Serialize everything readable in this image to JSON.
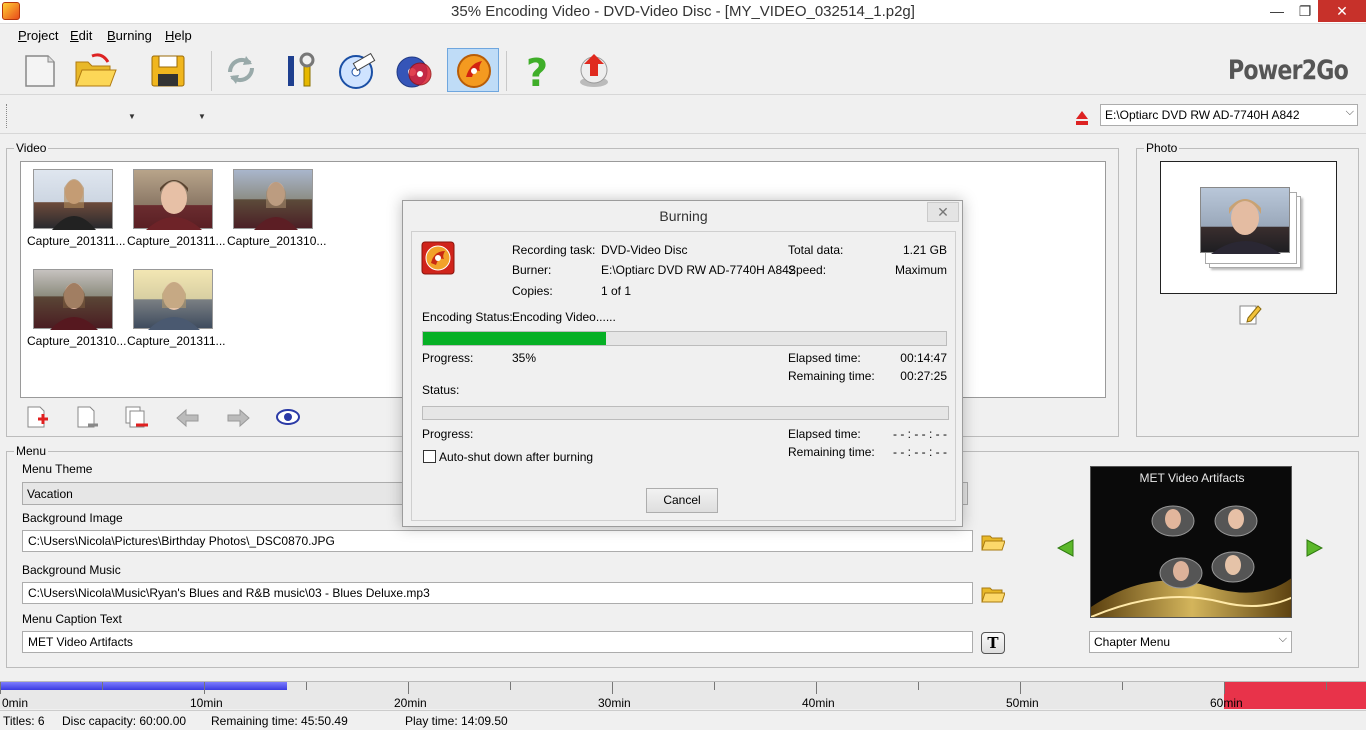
{
  "window": {
    "title": "35% Encoding Video - DVD-Video Disc - [MY_VIDEO_032514_1.p2g]",
    "min_icon": "minimize-icon",
    "max_icon": "maximize-icon",
    "close_icon": "close-icon",
    "min_glyph": "—",
    "max_glyph": "❐",
    "close_glyph": "✕"
  },
  "menubar": {
    "items": [
      "Project",
      "Edit",
      "Burning",
      "Help"
    ]
  },
  "toolbar": {
    "brand": "Power2Go",
    "buttons": [
      "new-project",
      "open-project",
      "save-project",
      "refresh",
      "tools",
      "burn-settings",
      "disc-utilities",
      "burn",
      "help",
      "update"
    ]
  },
  "drive": {
    "selected": "E:\\Optiarc DVD RW AD-7740H A842"
  },
  "video": {
    "label": "Video",
    "items": [
      {
        "label": "Capture_201311..."
      },
      {
        "label": "Capture_201311..."
      },
      {
        "label": "Capture_201310..."
      },
      {
        "label": "Capture_201310..."
      },
      {
        "label": "Capture_201311..."
      }
    ]
  },
  "photo": {
    "label": "Photo"
  },
  "menu": {
    "label": "Menu",
    "theme_label": "Menu Theme",
    "theme_value": "Vacation",
    "bg_image_label": "Background Image",
    "bg_image_value": "C:\\Users\\Nicola\\Pictures\\Birthday Photos\\_DSC0870.JPG",
    "bg_music_label": "Background Music",
    "bg_music_value": "C:\\Users\\Nicola\\Music\\Ryan's Blues and R&B music\\03 - Blues Deluxe.mp3",
    "caption_label": "Menu Caption Text",
    "caption_value": "MET Video Artifacts",
    "text_button": "T",
    "preview_title": "MET Video Artifacts",
    "chapter_select": "Chapter Menu"
  },
  "timeline": {
    "labels": [
      "0min",
      "10min",
      "20min",
      "30min",
      "40min",
      "50min",
      "60min"
    ],
    "used_fraction": 0.2347,
    "colors": {
      "used": "#4a4ae8",
      "over": "#e8334a"
    }
  },
  "status": {
    "titles": "Titles: 6",
    "capacity": "Disc capacity: 60:00.00",
    "remaining": "Remaining time: 45:50.49",
    "play": "Play time: 14:09.50"
  },
  "dialog": {
    "title": "Burning",
    "recording_task_label": "Recording task:",
    "recording_task_value": "DVD-Video Disc",
    "burner_label": "Burner:",
    "burner_value": "E:\\Optiarc DVD RW AD-7740H A842",
    "copies_label": "Copies:",
    "copies_value": "1 of 1",
    "total_data_label": "Total data:",
    "total_data_value": "1.21 GB",
    "speed_label": "Speed:",
    "speed_value": "Maximum",
    "encoding_status_label": "Encoding Status:",
    "encoding_status_value": "Encoding Video......",
    "encoding_progress_fraction": 0.35,
    "progress_label": "Progress:",
    "progress_value": "35%",
    "elapsed_label": "Elapsed time:",
    "elapsed_value": "00:14:47",
    "remaining_label": "Remaining time:",
    "remaining_value": "00:27:25",
    "status_label": "Status:",
    "status_progress_fraction": 0,
    "progress2_label": "Progress:",
    "elapsed2_label": "Elapsed time:",
    "elapsed2_value": "- - : - - : - -",
    "remaining2_label": "Remaining time:",
    "remaining2_value": "- - : - - : - -",
    "autoshutdown_label": "Auto-shut down after burning",
    "autoshutdown_checked": false,
    "cancel_label": "Cancel",
    "close_glyph": "✕",
    "progress_color": "#06b025"
  }
}
